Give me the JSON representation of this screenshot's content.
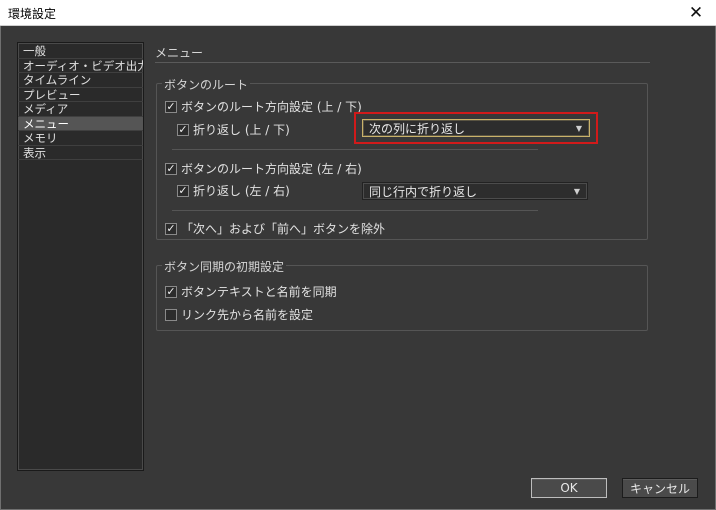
{
  "window": {
    "title": "環境設定",
    "close_icon": "close-icon"
  },
  "sidebar": {
    "items": [
      {
        "label": "一般"
      },
      {
        "label": "オーディオ・ビデオ出力"
      },
      {
        "label": "タイムライン"
      },
      {
        "label": "プレビュー"
      },
      {
        "label": "メディア"
      },
      {
        "label": "メニュー",
        "selected": true
      },
      {
        "label": "メモリ"
      },
      {
        "label": "表示"
      }
    ]
  },
  "main": {
    "page_title": "メニュー",
    "routing_group": {
      "title": "ボタンのルート",
      "vertical": {
        "label": "ボタンのルート方向設定 (上 / 下)",
        "checked": true,
        "wrap_label": "折り返し (上 / 下)",
        "wrap_checked": true,
        "dropdown_value": "次の列に折り返し"
      },
      "horizontal": {
        "label": "ボタンのルート方向設定 (左 / 右)",
        "checked": true,
        "wrap_label": "折り返し (左 / 右)",
        "wrap_checked": true,
        "dropdown_value": "同じ行内で折り返し"
      },
      "exclude": {
        "label": "「次へ」および「前へ」ボタンを除外",
        "checked": true
      }
    },
    "sync_group": {
      "title": "ボタン同期の初期設定",
      "sync_text": {
        "label": "ボタンテキストと名前を同期",
        "checked": true
      },
      "link_name": {
        "label": "リンク先から名前を設定",
        "checked": false
      }
    }
  },
  "footer": {
    "ok_label": "OK",
    "cancel_label": "キャンセル"
  },
  "colors": {
    "background": "#383838",
    "panel": "#2a2a2a",
    "highlight": "#d11a1a",
    "active_border": "#c9b26a"
  }
}
